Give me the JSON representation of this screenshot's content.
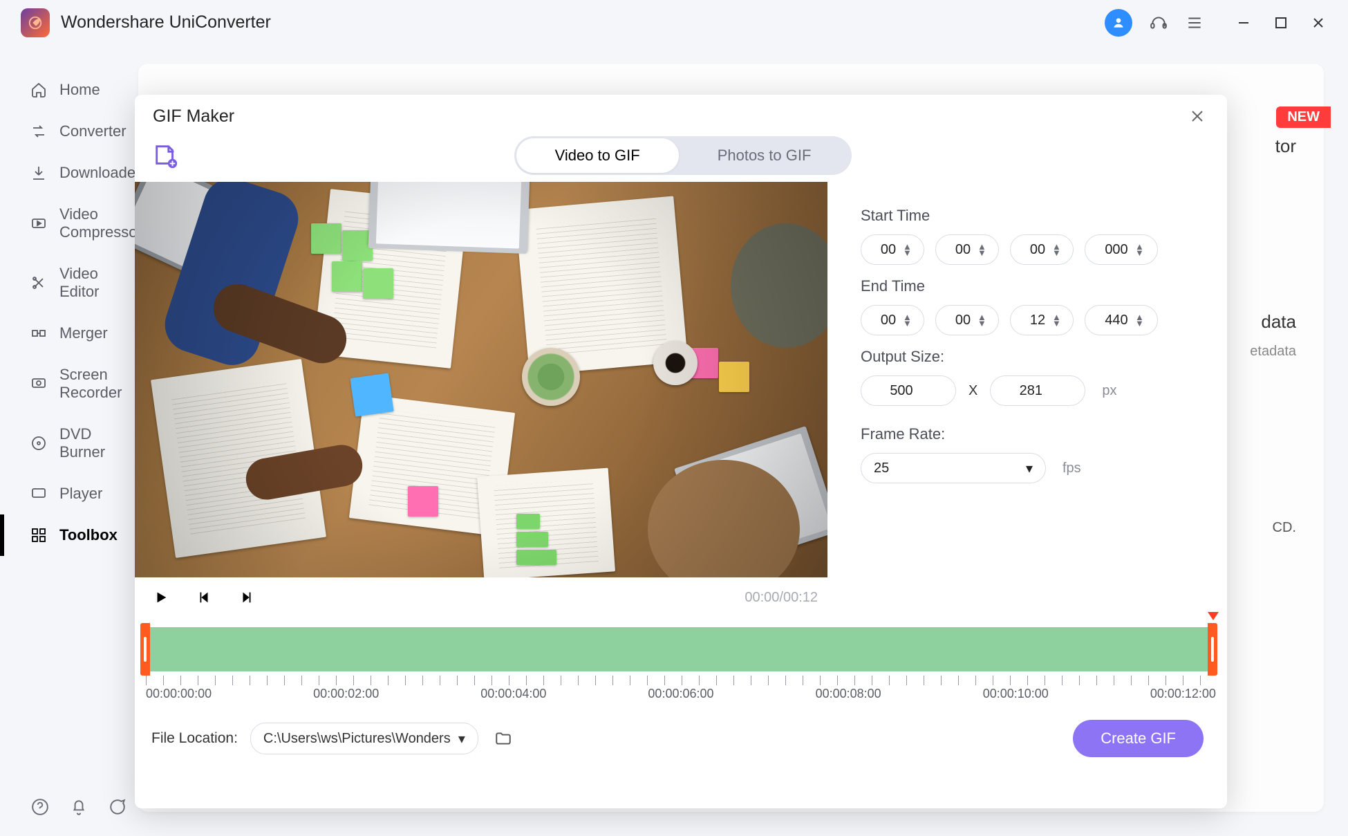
{
  "app": {
    "title": "Wondershare UniConverter"
  },
  "titlebar_icons": {
    "avatar": "user-icon",
    "headset": "headset-icon",
    "menu": "menu-icon",
    "minimize": "–",
    "maximize": "☐",
    "close": "✕"
  },
  "sidebar": {
    "items": [
      {
        "id": "home",
        "label": "Home"
      },
      {
        "id": "converter",
        "label": "Converter"
      },
      {
        "id": "downloader",
        "label": "Downloader"
      },
      {
        "id": "video-compressor",
        "label": "Video Compressor"
      },
      {
        "id": "video-editor",
        "label": "Video Editor"
      },
      {
        "id": "merger",
        "label": "Merger"
      },
      {
        "id": "screen-recorder",
        "label": "Screen Recorder"
      },
      {
        "id": "dvd-burner",
        "label": "DVD Burner"
      },
      {
        "id": "player",
        "label": "Player"
      },
      {
        "id": "toolbox",
        "label": "Toolbox"
      }
    ],
    "active_id": "toolbox"
  },
  "background_partial": {
    "badge_new": "NEW",
    "word_tor": "tor",
    "word_data": "data",
    "word_metadata": "etadata",
    "word_cd": "CD."
  },
  "modal": {
    "title": "GIF Maker",
    "tabs": {
      "video": "Video to GIF",
      "photos": "Photos to GIF",
      "active": "video"
    },
    "preview": {
      "current_time": "00:00",
      "total_time": "00:12",
      "readout": "00:00/00:12"
    },
    "params": {
      "start_label": "Start Time",
      "end_label": "End Time",
      "start": {
        "hh": "00",
        "mm": "00",
        "ss": "00",
        "ms": "000"
      },
      "end": {
        "hh": "00",
        "mm": "00",
        "ss": "12",
        "ms": "440"
      },
      "size_label": "Output Size:",
      "size_w": "500",
      "size_h": "281",
      "size_separator": "X",
      "size_unit": "px",
      "fr_label": "Frame Rate:",
      "fr_value": "25",
      "fr_unit": "fps"
    },
    "timeline": {
      "marks": [
        "00:00:00:00",
        "00:00:02:00",
        "00:00:04:00",
        "00:00:06:00",
        "00:00:08:00",
        "00:00:10:00",
        "00:00:12:00"
      ]
    },
    "footer": {
      "label": "File Location:",
      "path": "C:\\Users\\ws\\Pictures\\Wonders",
      "button": "Create GIF"
    }
  }
}
